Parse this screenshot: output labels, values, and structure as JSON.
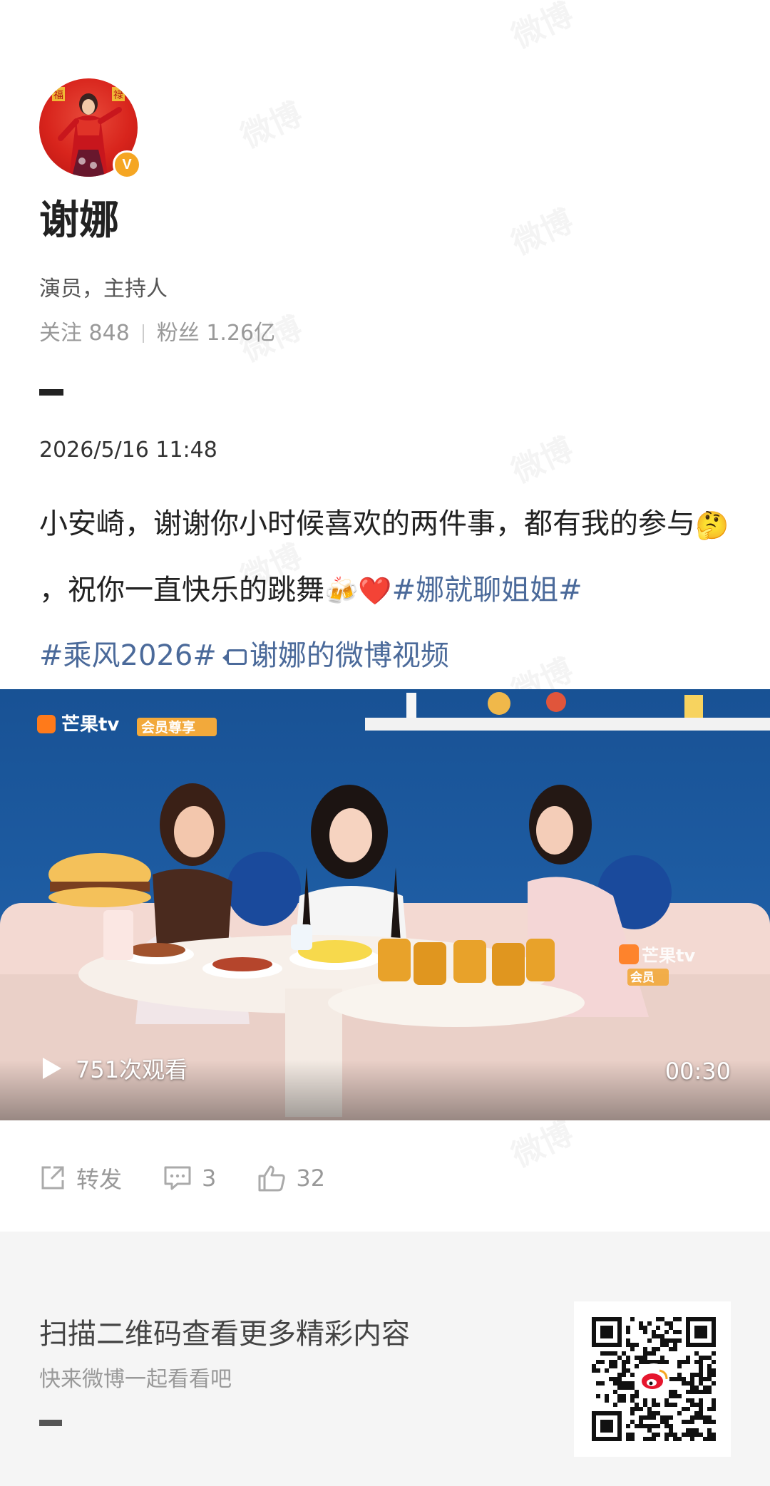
{
  "profile": {
    "name": "谢娜",
    "bio": "演员，主持人",
    "following_label": "关注 848",
    "followers_label": "粉丝 1.26亿",
    "verified_mark": "V",
    "avatar_text_left": "福",
    "avatar_text_right": "禄"
  },
  "post": {
    "time": "2026/5/16 11:48",
    "text_part1": "小安崎，谢谢你小时候喜欢的两件事，都有我的参与",
    "emoji_thinking": "🤔",
    "text_part2": "，祝你一直快乐的跳舞",
    "emoji_beers": "🍻",
    "emoji_heart": "❤️",
    "hashtag1": "#娜就聊姐姐#",
    "hashtag2": "#乘风2026#",
    "video_link": "谢娜的微博视频"
  },
  "video": {
    "views": "751次观看",
    "duration": "00:30",
    "logo_text": "芒果tv",
    "logo_badge": "会员尊享",
    "corner_logo": "芒果tv",
    "corner_badge": "会员"
  },
  "actions": {
    "repost": "转发",
    "comments": "3",
    "likes": "32"
  },
  "footer": {
    "title": "扫描二维码查看更多精彩内容",
    "subtitle": "快来微博一起看看吧"
  },
  "watermark": "微博",
  "colors": {
    "link": "#4b6a9a",
    "verified": "#f5a623",
    "video_bg": "#1f5b9e"
  }
}
